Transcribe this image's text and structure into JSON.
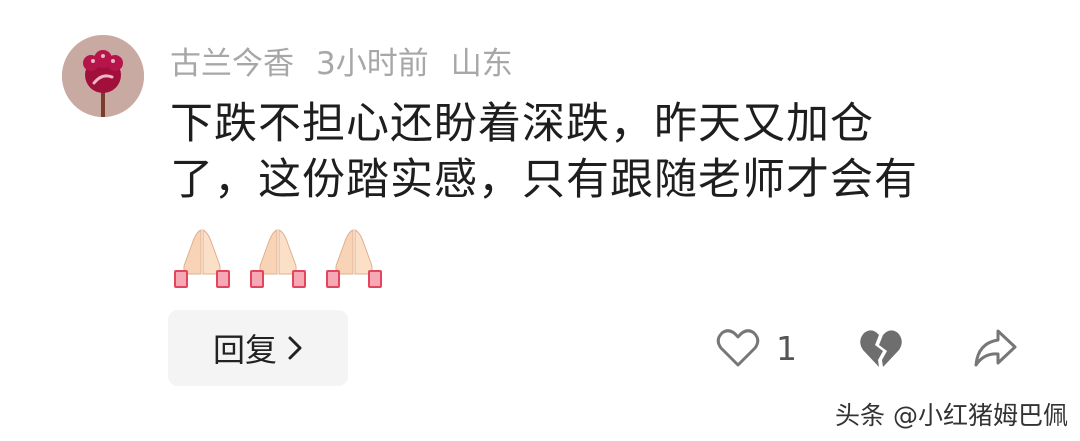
{
  "comment": {
    "author": "古兰今香",
    "time": "3小时前",
    "location": "山东",
    "text_lines": [
      "下跌不担心还盼着深跌，昨天又加仓",
      "了，这份踏实感，只有跟随老师才会有"
    ],
    "emoji": [
      "folded-hands",
      "folded-hands",
      "folded-hands"
    ]
  },
  "actions": {
    "reply_label": "回复",
    "like_count": "1",
    "like_icon": "heart-outline-icon",
    "dislike_icon": "broken-heart-icon",
    "share_icon": "share-arrow-icon"
  },
  "watermark": "头条 @小红猪姆巴佩",
  "colors": {
    "avatar_bg": "#c9aaa2",
    "avatar_flower": "#a0103a",
    "meta_text": "#a7a7a7",
    "button_bg": "#f4f4f4",
    "icon_gray": "#777777"
  }
}
